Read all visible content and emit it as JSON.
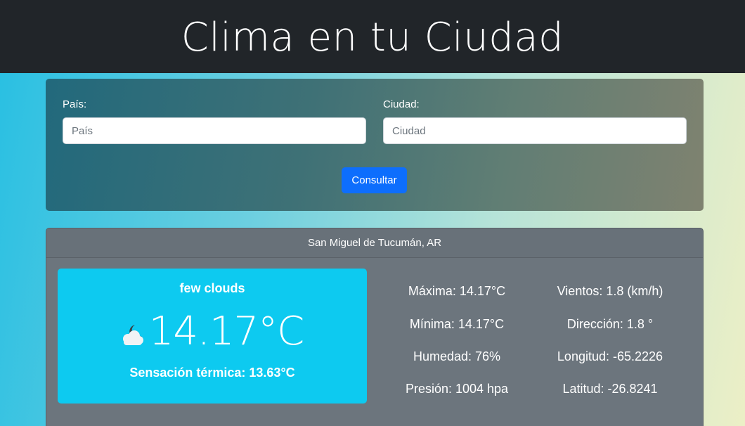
{
  "header": {
    "title": "Clima en tu Ciudad"
  },
  "form": {
    "country_label": "País:",
    "country_placeholder": "País",
    "city_label": "Ciudad:",
    "city_placeholder": "Ciudad",
    "submit_label": "Consultar"
  },
  "result": {
    "location": "San Miguel de Tucumán, AR",
    "description": "few clouds",
    "icon": "few-clouds-icon",
    "temperature": "14.17°C",
    "feels_like": "Sensación térmica: 13.63°C",
    "stats": {
      "max": "Máxima: 14.17°C",
      "min": "Mínima: 14.17°C",
      "humidity": "Humedad: 76%",
      "pressure": "Presión: 1004 hpa",
      "wind": "Vientos: 1.8 (km/h)",
      "direction": "Dirección: 1.8 °",
      "longitude": "Longitud: -65.2226",
      "latitude": "Latitud: -26.8241"
    }
  },
  "colors": {
    "navbar": "#212529",
    "button": "#0d6efd",
    "main_box": "#0dcaf0",
    "card": "#6c757d"
  }
}
